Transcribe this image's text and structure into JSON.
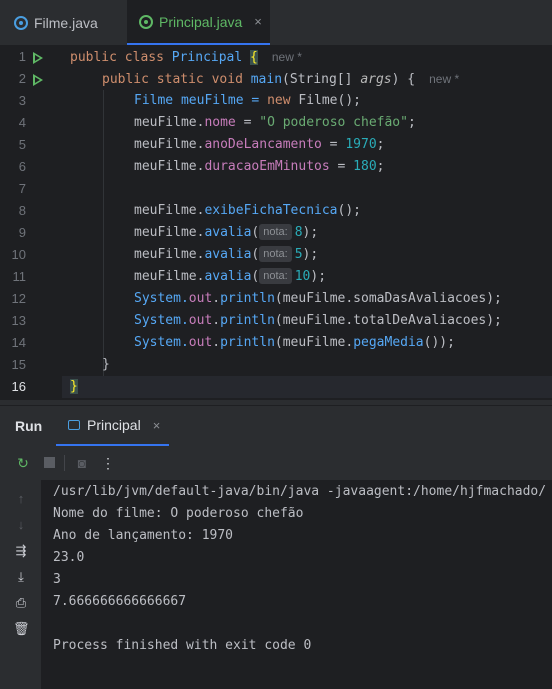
{
  "tabs": [
    {
      "label": "Filme.java",
      "active": false
    },
    {
      "label": "Principal.java",
      "active": true,
      "close": "×"
    }
  ],
  "editor": {
    "line_numbers": [
      "1",
      "2",
      "3",
      "4",
      "5",
      "6",
      "7",
      "8",
      "9",
      "10",
      "11",
      "12",
      "13",
      "14",
      "15",
      "16"
    ],
    "new_hint": "new *",
    "param_hint": "nota:",
    "code": {
      "l1": {
        "kw1": "public",
        "kw2": "class",
        "cls": "Principal",
        "brace": "{"
      },
      "l2": {
        "kw1": "public",
        "kw2": "static",
        "kw3": "void",
        "mth": "main",
        "params": "(String[]",
        "arg": "args",
        "rest": ") {"
      },
      "l3": {
        "t1": "Filme meuFilme = ",
        "kw": "new",
        "t2": " Filme();"
      },
      "l4": {
        "t1": "meuFilme.",
        "fld": "nome",
        "t2": " = ",
        "str": "\"O poderoso chefão\"",
        "t3": ";"
      },
      "l5": {
        "t1": "meuFilme.",
        "fld": "anoDeLancamento",
        "t2": " = ",
        "num": "1970",
        "t3": ";"
      },
      "l6": {
        "t1": "meuFilme.",
        "fld": "duracaoEmMinutos",
        "t2": " = ",
        "num": "180",
        "t3": ";"
      },
      "l8": {
        "t1": "meuFilme.",
        "call": "exibeFichaTecnica",
        "t2": "();"
      },
      "l9": {
        "t1": "meuFilme.",
        "call": "avalia",
        "t2": "(",
        "num": "8",
        "t3": ");"
      },
      "l10": {
        "t1": "meuFilme.",
        "call": "avalia",
        "t2": "(",
        "num": "5",
        "t3": ");"
      },
      "l11": {
        "t1": "meuFilme.",
        "call": "avalia",
        "t2": "(",
        "num": "10",
        "t3": ");"
      },
      "l12": {
        "t1": "System.",
        "fld": "out",
        "t2": ".",
        "call": "println",
        "t3": "(meuFilme.somaDasAvaliacoes);"
      },
      "l13": {
        "t1": "System.",
        "fld": "out",
        "t2": ".",
        "call": "println",
        "t3": "(meuFilme.totalDeAvaliacoes);"
      },
      "l14": {
        "t1": "System.",
        "fld": "out",
        "t2": ".",
        "call": "println",
        "t3": "(meuFilme.",
        "call2": "pegaMedia",
        "t4": "());"
      },
      "l15": {
        "t1": "}"
      },
      "l16": {
        "t1": "}"
      }
    }
  },
  "run_panel": {
    "title": "Run",
    "tab_label": "Principal",
    "tab_close": "×",
    "output": [
      "/usr/lib/jvm/default-java/bin/java -javaagent:/home/hjfmachado/",
      "Nome do filme: O poderoso chefão",
      "Ano de lançamento: 1970",
      "23.0",
      "3",
      "7.666666666666667",
      "",
      "Process finished with exit code 0"
    ]
  }
}
